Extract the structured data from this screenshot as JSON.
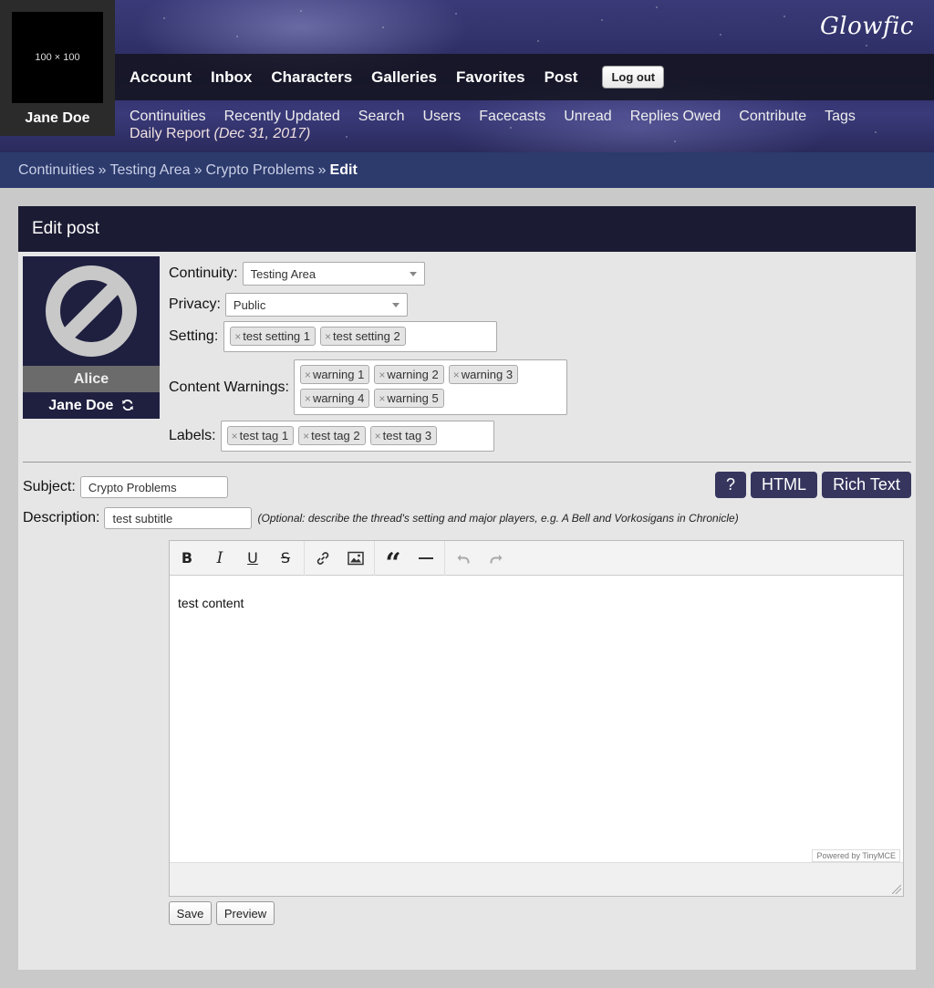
{
  "header": {
    "avatar_placeholder": "100 × 100",
    "user_name": "Jane Doe",
    "logo": "Glowfic",
    "main_nav": [
      "Account",
      "Inbox",
      "Characters",
      "Galleries",
      "Favorites",
      "Post"
    ],
    "logout_label": "Log out",
    "sub_nav": [
      "Continuities",
      "Recently Updated",
      "Search",
      "Users",
      "Facecasts",
      "Unread",
      "Replies Owed",
      "Contribute",
      "Tags"
    ],
    "daily_report": "Daily Report",
    "daily_date": "(Dec 31, 2017)"
  },
  "breadcrumb": {
    "items": [
      "Continuities",
      "Testing Area",
      "Crypto Problems"
    ],
    "separator": "»",
    "current": "Edit"
  },
  "panel": {
    "title": "Edit post",
    "character": {
      "name": "Alice",
      "user": "Jane Doe"
    },
    "continuity": {
      "label": "Continuity:",
      "value": "Testing Area"
    },
    "privacy": {
      "label": "Privacy:",
      "value": "Public"
    },
    "setting": {
      "label": "Setting:",
      "tags": [
        "test setting 1",
        "test setting 2"
      ]
    },
    "warnings": {
      "label": "Content Warnings:",
      "tags": [
        "warning 1",
        "warning 2",
        "warning 3",
        "warning 4",
        "warning 5"
      ]
    },
    "labels": {
      "label": "Labels:",
      "tags": [
        "test tag 1",
        "test tag 2",
        "test tag 3"
      ]
    },
    "subject": {
      "label": "Subject:",
      "value": "Crypto Problems"
    },
    "description": {
      "label": "Description:",
      "value": "test subtitle",
      "hint": "(Optional: describe the thread's setting and major players, e.g. A Bell and Vorkosigans in Chronicle)"
    },
    "mode_buttons": {
      "help": "?",
      "html": "HTML",
      "rich": "Rich Text"
    },
    "editor": {
      "content": "test content",
      "powered_by": "Powered by TinyMCE",
      "toolbar": [
        "bold-icon",
        "italic-icon",
        "underline-icon",
        "strikethrough-icon",
        "link-icon",
        "image-icon",
        "blockquote-icon",
        "horizontal-rule-icon",
        "undo-icon",
        "redo-icon"
      ]
    },
    "save_label": "Save",
    "preview_label": "Preview"
  },
  "colors": {
    "breadcrumb_bg": "#2c3a6c",
    "panel_header_bg": "#1b1b33",
    "mode_button_bg": "#35355e"
  }
}
